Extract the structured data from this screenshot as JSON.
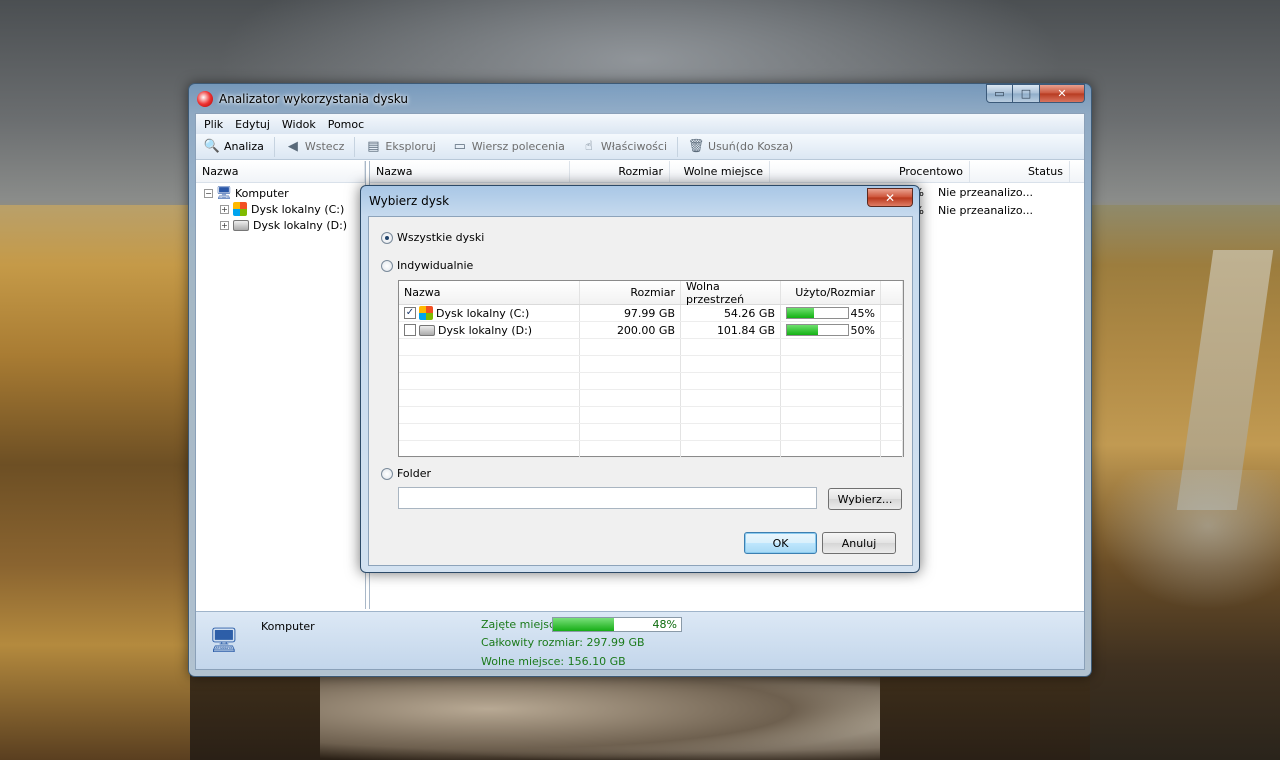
{
  "window": {
    "title": "Analizator wykorzystania dysku",
    "caption": {
      "minimize": "▭",
      "maximize": "□",
      "close": "✕"
    }
  },
  "menu": [
    "Plik",
    "Edytuj",
    "Widok",
    "Pomoc"
  ],
  "toolbar": {
    "analyze": "Analiza",
    "back": "Wstecz",
    "explore": "Eksploruj",
    "cmd": "Wiersz polecenia",
    "props": "Właściwości",
    "delete": "Usuń(do Kosza)"
  },
  "tree": {
    "header": "Nazwa",
    "root": "Komputer",
    "items": [
      "Dysk lokalny (C:)",
      "Dysk lokalny (D:)"
    ]
  },
  "list": {
    "columns": [
      "Nazwa",
      "Rozmiar",
      "Wolne miejsce",
      "Procentowo",
      "Status"
    ],
    "rows": [
      {
        "percent": "45%",
        "status": "Nie przeanalizo...",
        "fill": 45
      },
      {
        "percent": "50%",
        "status": "Nie przeanalizo...",
        "fill": 50
      }
    ]
  },
  "statusbar": {
    "label": "Komputer",
    "used_label": "Zajęte miejsce",
    "used_percent": "48%",
    "used_fill": 48,
    "total": "Całkowity rozmiar: 297.99 GB",
    "free": "Wolne miejsce: 156.10 GB"
  },
  "dialog": {
    "title": "Wybierz dysk",
    "close": "✕",
    "opt_all": "Wszystkie dyski",
    "opt_individual": "Indywidualnie",
    "opt_folder": "Folder",
    "columns": [
      "Nazwa",
      "Rozmiar",
      "Wolna przestrzeń",
      "Użyto/Rozmiar"
    ],
    "drives": [
      {
        "name": "Dysk lokalny (C:)",
        "size": "97.99 GB",
        "free": "54.26 GB",
        "used": "45%",
        "fill": 45,
        "checked": true
      },
      {
        "name": "Dysk lokalny (D:)",
        "size": "200.00 GB",
        "free": "101.84 GB",
        "used": "50%",
        "fill": 50,
        "checked": false
      }
    ],
    "folder_value": "",
    "browse": "Wybierz...",
    "ok": "OK",
    "cancel": "Anuluj"
  }
}
